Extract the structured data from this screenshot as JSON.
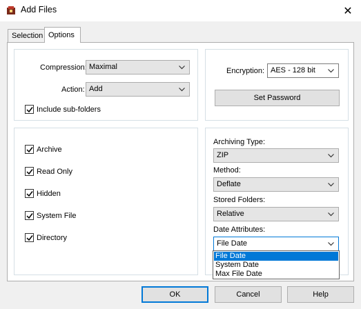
{
  "window": {
    "title": "Add Files",
    "close_glyph": "✕"
  },
  "tabs": [
    {
      "label": "Selection",
      "active": false
    },
    {
      "label": "Options",
      "active": true
    }
  ],
  "compression": {
    "label": "Compression:",
    "value": "Maximal"
  },
  "action": {
    "label": "Action:",
    "value": "Add"
  },
  "include_subfolders": {
    "label": "Include sub-folders",
    "checked": true
  },
  "encryption": {
    "label": "Encryption:",
    "value": "AES - 128 bit"
  },
  "set_password_label": "Set Password",
  "attributes": [
    {
      "label": "Archive",
      "checked": true
    },
    {
      "label": "Read Only",
      "checked": true
    },
    {
      "label": "Hidden",
      "checked": true
    },
    {
      "label": "System File",
      "checked": true
    },
    {
      "label": "Directory",
      "checked": true
    }
  ],
  "archiving_type": {
    "label": "Archiving Type:",
    "value": "ZIP"
  },
  "method": {
    "label": "Method:",
    "value": "Deflate"
  },
  "stored_folders": {
    "label": "Stored Folders:",
    "value": "Relative"
  },
  "date_attributes": {
    "label": "Date Attributes:",
    "value": "File Date",
    "options": [
      "File Date",
      "System Date",
      "Max File Date"
    ],
    "selected_index": 0
  },
  "buttons": {
    "ok": "OK",
    "cancel": "Cancel",
    "help": "Help"
  },
  "colors": {
    "accent": "#0078d7",
    "window_bg": "#f0f0f0"
  }
}
